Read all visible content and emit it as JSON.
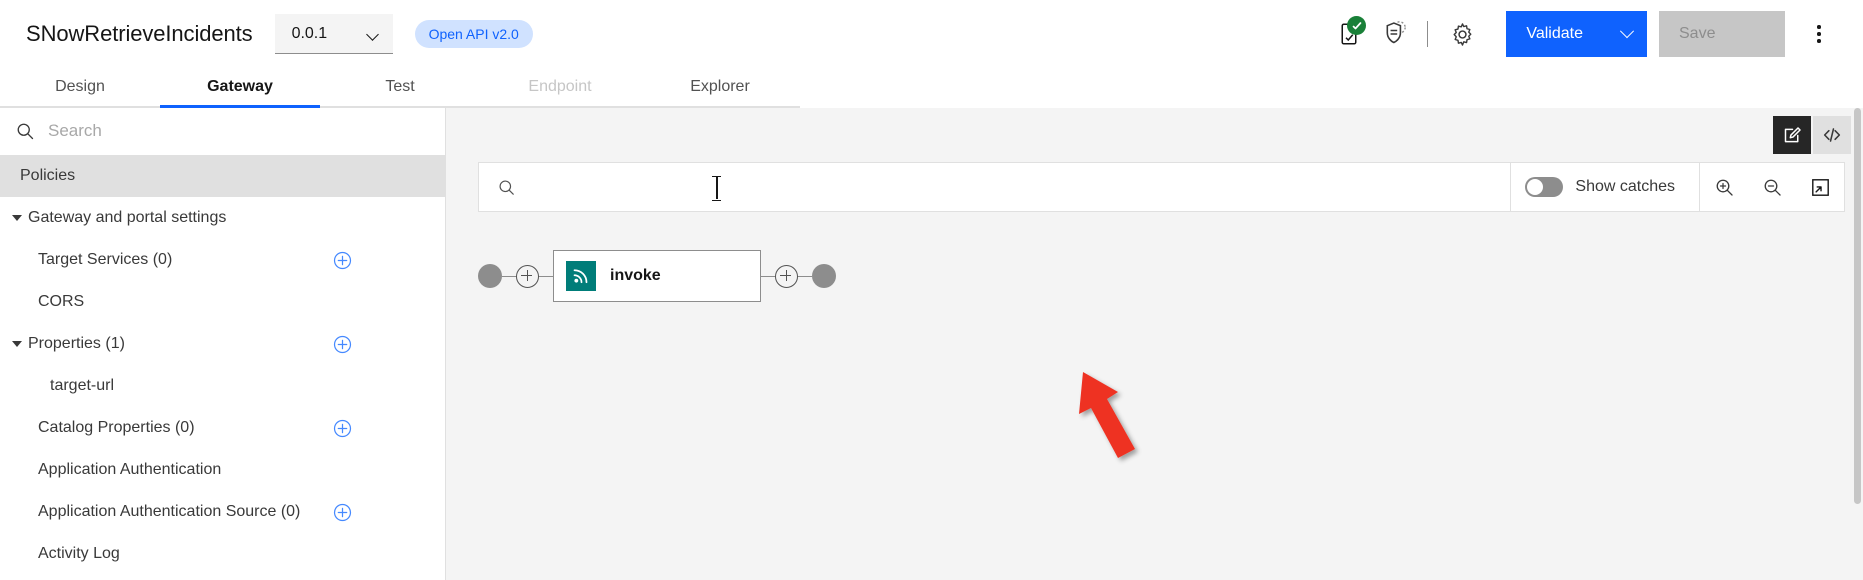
{
  "header": {
    "app_title": "SNowRetrieveIncidents",
    "version_value": "0.0.1",
    "version_icon": "chevron-down-icon",
    "api_badge": "Open API v2.0",
    "icons": [
      {
        "name": "document-check-icon",
        "status": "valid",
        "status_color": "#198038"
      },
      {
        "name": "policy-shield-icon"
      },
      {
        "name": "gear-icon"
      }
    ],
    "validate_label": "Validate",
    "validate_color": "#0f62fe",
    "save_label": "Save",
    "save_disabled": true,
    "overflow_icon": "overflow-menu-icon"
  },
  "tabs": [
    {
      "label": "Design",
      "active": false,
      "disabled": false
    },
    {
      "label": "Gateway",
      "active": true,
      "disabled": false
    },
    {
      "label": "Test",
      "active": false,
      "disabled": false
    },
    {
      "label": "Endpoint",
      "active": false,
      "disabled": true
    },
    {
      "label": "Explorer",
      "active": false,
      "disabled": false
    }
  ],
  "sidebar": {
    "search": {
      "placeholder": "Search",
      "value": "",
      "icon": "search-icon"
    },
    "items": [
      {
        "label": "Policies",
        "indent": 0,
        "selected": true,
        "caret": false,
        "plus": false
      },
      {
        "label": "Gateway and portal settings",
        "indent": 1,
        "selected": false,
        "caret": true,
        "plus": false
      },
      {
        "label": "Target Services (0)",
        "indent": 2,
        "selected": false,
        "caret": false,
        "plus": true
      },
      {
        "label": "CORS",
        "indent": 2,
        "selected": false,
        "caret": false,
        "plus": false
      },
      {
        "label": "Properties (1)",
        "indent": 1,
        "selected": false,
        "caret": true,
        "plus": true
      },
      {
        "label": "target-url",
        "indent": 3,
        "selected": false,
        "caret": false,
        "plus": false
      },
      {
        "label": "Catalog Properties (0)",
        "indent": 2,
        "selected": false,
        "caret": false,
        "plus": true
      },
      {
        "label": "Application Authentication",
        "indent": 2,
        "selected": false,
        "caret": false,
        "plus": false
      },
      {
        "label": "Application Authentication Source (0)",
        "indent": 2,
        "selected": false,
        "caret": false,
        "plus": true
      },
      {
        "label": "Activity Log",
        "indent": 2,
        "selected": false,
        "caret": false,
        "plus": false
      }
    ]
  },
  "main": {
    "view_toggle": [
      {
        "name": "edit-view-icon",
        "active": true
      },
      {
        "name": "code-view-icon",
        "active": false
      }
    ],
    "toolbar": {
      "search_placeholder": "",
      "search_value": "",
      "search_icon": "search-icon",
      "show_catches_label": "Show catches",
      "show_catches_on": false,
      "zoom_in_icon": "zoom-in-icon",
      "zoom_out_icon": "zoom-out-icon",
      "fit_icon": "fit-to-screen-icon"
    },
    "flow": {
      "start_node": "start-circle",
      "end_node": "end-circle",
      "add_before_icon": "plus-circle-icon",
      "add_after_icon": "plus-circle-icon",
      "nodes": [
        {
          "label": "invoke",
          "icon": "invoke-signal-icon",
          "icon_color": "#007d79"
        }
      ]
    },
    "annotation": {
      "name": "red-arrow-annotation",
      "color": "#ee3124"
    }
  }
}
